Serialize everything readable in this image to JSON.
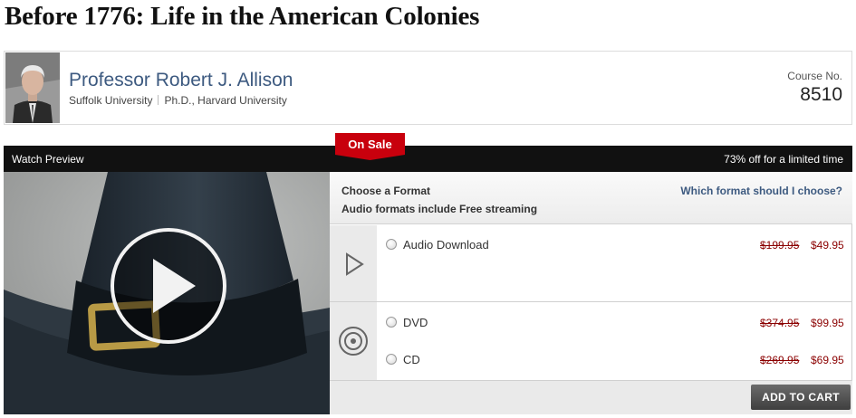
{
  "page": {
    "title": "Before 1776: Life in the American Colonies"
  },
  "professor": {
    "name": "Professor Robert J. Allison",
    "school": "Suffolk University",
    "degree": "Ph.D., Harvard University",
    "course_label": "Course No.",
    "course_number": "8510"
  },
  "promo": {
    "badge": "On Sale",
    "watch_preview": "Watch Preview",
    "discount_text": "73% off for a limited time"
  },
  "formats": {
    "heading": "Choose a Format",
    "subheading": "Audio formats include Free streaming",
    "help_link": "Which format should I choose?",
    "options": [
      {
        "label": "Audio Download",
        "old_price": "$199.95",
        "new_price": "$49.95"
      },
      {
        "label": "DVD",
        "old_price": "$374.95",
        "new_price": "$99.95"
      },
      {
        "label": "CD",
        "old_price": "$269.95",
        "new_price": "$69.95"
      }
    ],
    "add_to_cart": "ADD TO CART"
  },
  "icons": {
    "play": "play-icon",
    "audio_format": "audio-play-icon",
    "disc_format": "disc-icon"
  },
  "colors": {
    "sale_red": "#c8000d",
    "link_blue": "#3d5a80",
    "price_red": "#8b0000",
    "bar_black": "#111111"
  }
}
